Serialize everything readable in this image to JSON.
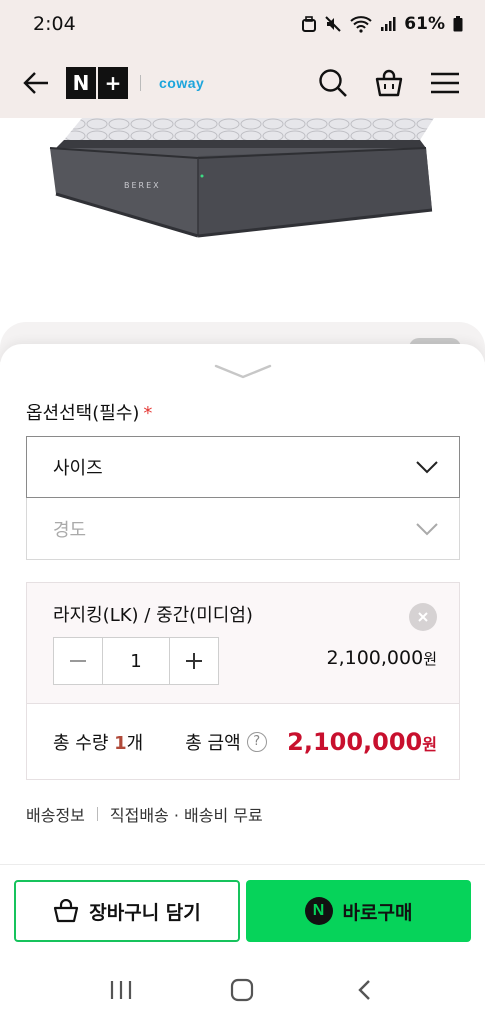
{
  "status_bar": {
    "time": "2:04",
    "battery": "61%"
  },
  "header": {
    "brand_n": "N",
    "brand_plus": "+",
    "partner": "coway",
    "icons": [
      "back-arrow-icon",
      "search-icon",
      "basket-icon",
      "menu-icon"
    ]
  },
  "product": {
    "mattress_brand": "BEREX"
  },
  "options": {
    "title": "옵션선택(필수)",
    "required_mark": "*",
    "size_label": "사이즈",
    "firmness_label": "경도"
  },
  "selected_item": {
    "name": "라지킹(LK) / 중간(미디엄)",
    "quantity": "1",
    "price": "2,100,000",
    "price_unit": "원"
  },
  "totals": {
    "qty_label": "총 수량",
    "qty_value": "1",
    "qty_unit": "개",
    "amount_label": "총 금액",
    "help": "?",
    "amount": "2,100,000",
    "amount_unit": "원"
  },
  "shipping": {
    "label": "배송정보",
    "detail": "직접배송 · 배송비 무료"
  },
  "actions": {
    "cart_label": "장바구니 담기",
    "buy_label": "바로구매",
    "npay_mark": "N"
  },
  "colors": {
    "accent_green": "#06d35a",
    "price_red": "#c8102e",
    "header_bg": "#f3ecea",
    "coway_blue": "#1da5dc"
  }
}
